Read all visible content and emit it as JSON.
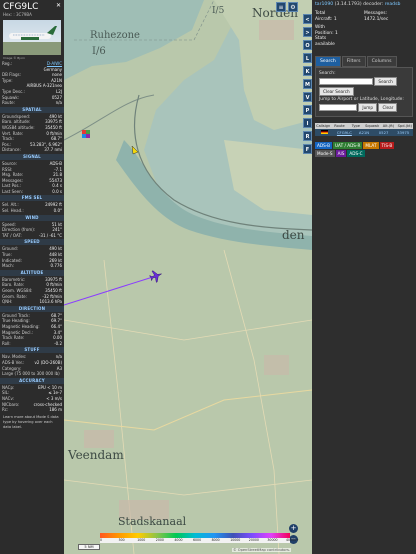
{
  "aircraft": {
    "callsign": "CFG9LC",
    "hex_line": "Hex: : 3C79BA",
    "photo_caption": "Image © Bjorn",
    "reg_label": "Reg.:",
    "reg": "D-AIWC",
    "country": "Germany",
    "db_flags_label": "DB Flags:",
    "db_flags": "none",
    "type_label": "Type:",
    "type": "A21N",
    "type_desc_full": "AIRBUS A-321neo",
    "type_desc_label": "Type Desc.:",
    "type_desc": "L2J",
    "squawk_label": "Squawk:",
    "squawk": "0527",
    "route_label": "Route:",
    "route": "n/a"
  },
  "sections": [
    {
      "title": "SPATIAL",
      "rows": [
        [
          "Groundspeed:",
          "490 kt"
        ],
        [
          "Baro. altitude:",
          "33975 ft"
        ],
        [
          "WGS84 altitude:",
          "35450 ft"
        ],
        [
          "Vert. Rate:",
          "0 ft/min"
        ],
        [
          "Track:",
          "68.7°"
        ],
        [
          "Pos.:",
          "53.283°, 6.962°"
        ],
        [
          "Distance:",
          "37.7 nmi"
        ]
      ]
    },
    {
      "title": "SIGNAL",
      "rows": [
        [
          "Source:",
          "ADS-B"
        ],
        [
          "RSSI:",
          "-7.1"
        ],
        [
          "Msg. Rate:",
          "21.8"
        ],
        [
          "Messages:",
          "55473"
        ],
        [
          "Last Pos.:",
          "0.4 s"
        ],
        [
          "Last Seen:",
          "0.0 s"
        ]
      ]
    },
    {
      "title": "FMS SEL",
      "rows": [
        [
          "Sel. Alt.:",
          "24992 ft"
        ],
        [
          "Sel. Head.:",
          "0.0°"
        ]
      ]
    },
    {
      "title": "WIND",
      "rows": [
        [
          "Speed:",
          "51 kt"
        ],
        [
          "Direction (from):",
          "241°"
        ],
        [
          "TAT / OAT:",
          "-31 / -61 °C"
        ]
      ]
    },
    {
      "title": "SPEED",
      "rows": [
        [
          "Ground:",
          "490 kt"
        ],
        [
          "True:",
          "448 kt"
        ],
        [
          "Indicated:",
          "269 kt"
        ],
        [
          "Mach:",
          "0.776"
        ]
      ]
    },
    {
      "title": "ALTITUDE",
      "rows": [
        [
          "Barometric:",
          "33975 ft"
        ],
        [
          "Baro. Rate:",
          "0 ft/min"
        ],
        [
          "Geom. WGS84:",
          "35450 ft"
        ],
        [
          "Geom. Rate:",
          "-32 ft/min"
        ],
        [
          "QNH:",
          "1013.6 hPa"
        ]
      ]
    },
    {
      "title": "DIRECTION",
      "rows": [
        [
          "Ground Track:",
          "68.7°"
        ],
        [
          "True Heading:",
          "69.7°"
        ],
        [
          "Magnetic Heading:",
          "66.4°"
        ],
        [
          "Magnetic Decl.:",
          "3.4°"
        ],
        [
          "Track Rate:",
          "0.00"
        ],
        [
          "Roll:",
          "-0.2"
        ]
      ]
    },
    {
      "title": "STUFF",
      "rows": [
        [
          "Nav. Modes:",
          "n/a"
        ],
        [
          "ADS-B Ver.:",
          "v2 (DO-260B)"
        ],
        [
          "Category:",
          "A3"
        ],
        [
          "Large (75 000 to 300 000 lb)",
          ""
        ]
      ]
    },
    {
      "title": "ACCURACY",
      "rows": [
        [
          "NACp:",
          "EPU < 10 m"
        ],
        [
          "SIL:",
          "≤ 1e-7"
        ],
        [
          "NACv:",
          "< 3 m/s"
        ],
        [
          "NICbaro:",
          "cross-checked"
        ],
        [
          "Rc:",
          "186 m"
        ]
      ]
    }
  ],
  "info_note": "Learn more about Mode S data type by hovering over each data label.",
  "map": {
    "labels": {
      "i5": "I/5",
      "ruhezone": "Ruhezone",
      "i6": "I/6",
      "norden": "Norden",
      "den": "den",
      "veendam": "Veendam",
      "stadskanaal": "Stadskanaal"
    },
    "scale_label": "5 NM",
    "attribution": "© OpenStreetMap contributors.",
    "altitude_ticks": [
      "0",
      "500",
      "1000",
      "2000",
      "4000",
      "6000",
      "8000",
      "10000",
      "20000",
      "30000",
      "40000+"
    ],
    "side_buttons": [
      "<",
      ">",
      "O",
      "L",
      "K",
      "M",
      "V",
      "P",
      "I",
      "R",
      "F"
    ],
    "top_buttons": [
      "≡",
      "⚙"
    ],
    "zoom_in": "+",
    "zoom_out": "−",
    "colors": {
      "water": "#a8c3b8",
      "land": "#b7c7a9",
      "track": "#8a3cff",
      "aircraft": "#6a2cd8"
    }
  },
  "panel": {
    "brand": "tar1090",
    "version": "(3.14.1793) decoder:",
    "readsb": "readsb",
    "total_label": "Total Aircraft: 1",
    "messages_label": "Messages:",
    "messages_value": "1472.1/sec",
    "with_pos": "With Position: 1",
    "stats_line": "Stats available",
    "tabs": [
      "Search",
      "Filters",
      "Columns"
    ],
    "search_label": "Search:",
    "search_btn": "Search",
    "clear_search": "Clear Search",
    "jump_label": "Jump to Airport or Latitude, Longitude:",
    "jump_btn": "Jump",
    "clear_btn": "Clear",
    "table_headers": [
      "Callsign",
      "Route",
      "Type",
      "Squawk",
      "Alt.(ft)",
      "Spd.(kt)"
    ],
    "row": {
      "callsign": "CFG9LC",
      "type": "A21N",
      "squawk": "0527",
      "alt": "33975"
    },
    "sources": [
      {
        "label": "ADS-B",
        "color": "#1565c0"
      },
      {
        "label": "UAT / ADS-R",
        "color": "#2e7d32"
      },
      {
        "label": "MLAT",
        "color": "#c77800"
      },
      {
        "label": "TIS-B",
        "color": "#b71c1c"
      },
      {
        "label": "Mode-S",
        "color": "#555555"
      },
      {
        "label": "AIS",
        "color": "#6a1b9a"
      },
      {
        "label": "ADS-C",
        "color": "#00695c"
      }
    ]
  }
}
